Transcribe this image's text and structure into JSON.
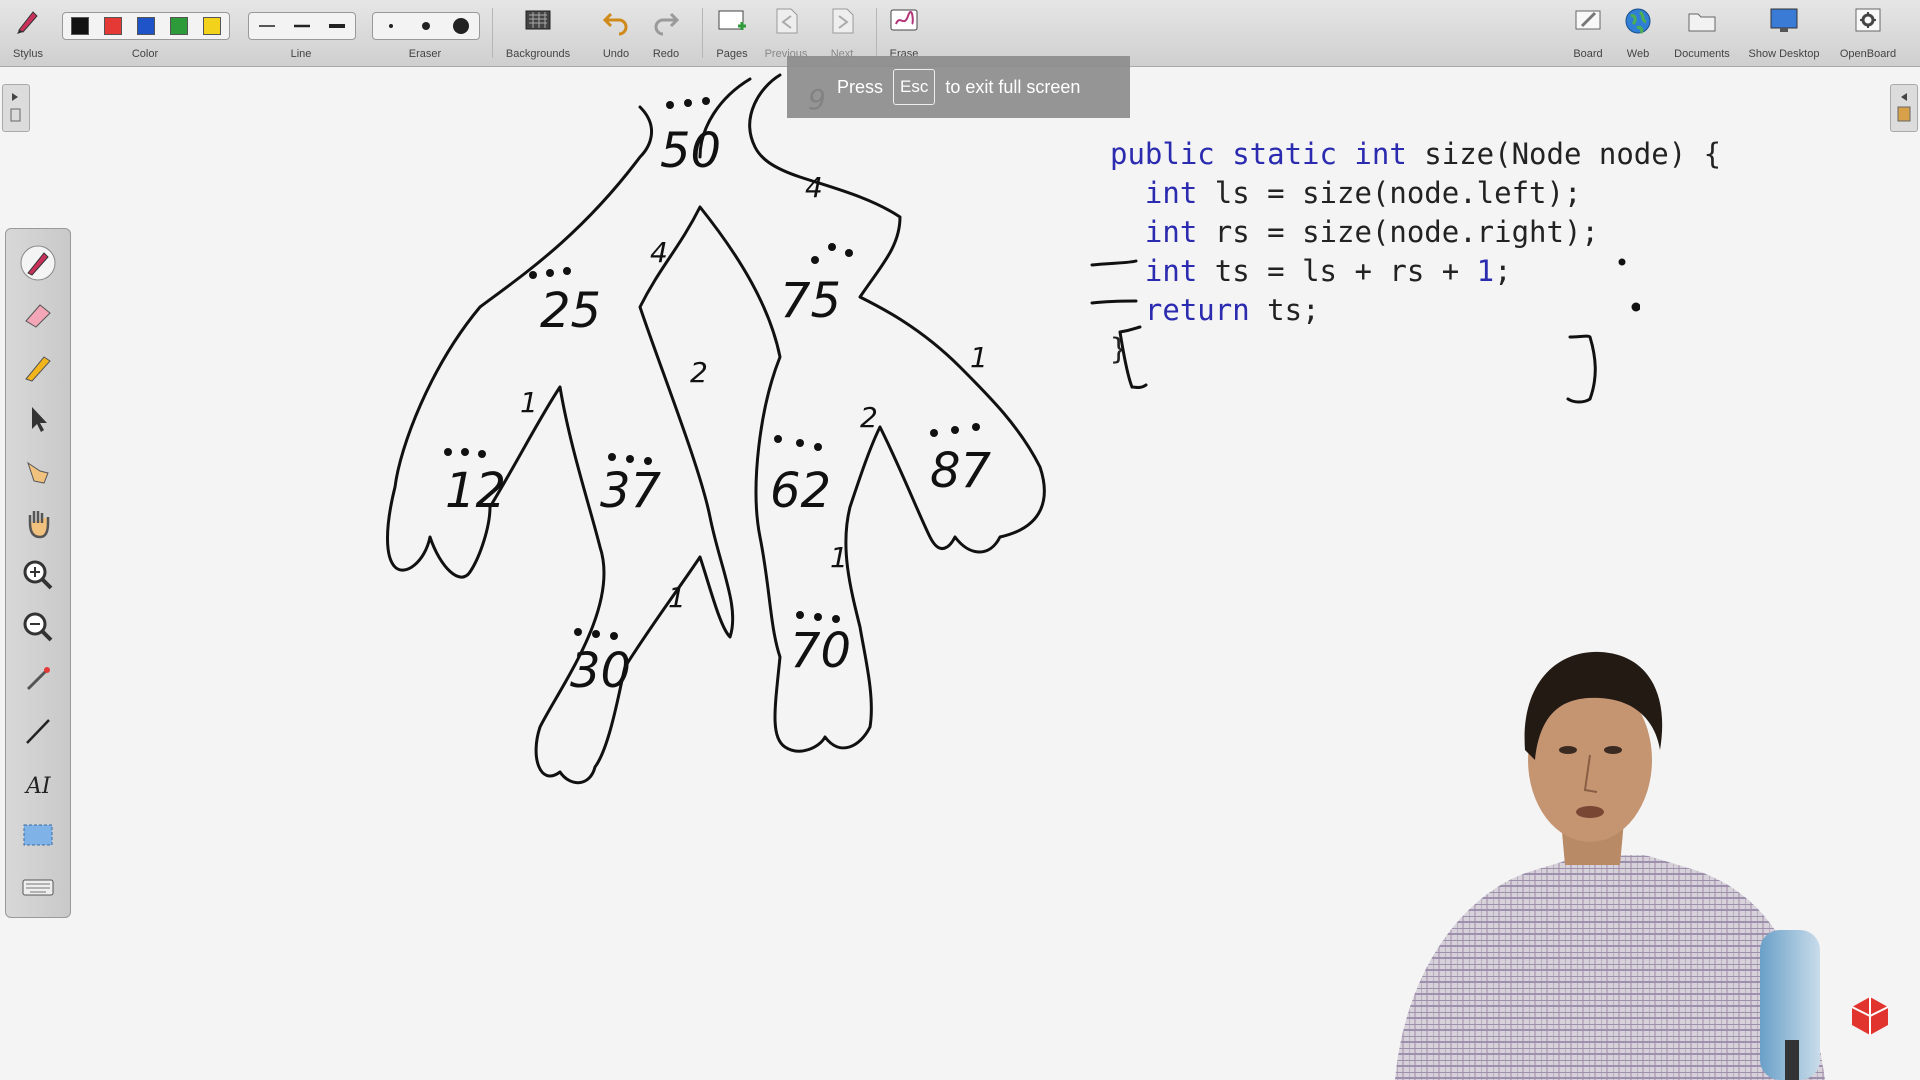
{
  "toolbar": {
    "stylus": "Stylus",
    "color": "Color",
    "line": "Line",
    "eraser": "Eraser",
    "backgrounds": "Backgrounds",
    "undo": "Undo",
    "redo": "Redo",
    "pages": "Pages",
    "previous": "Previous",
    "next": "Next",
    "erase": "Erase",
    "board": "Board",
    "web": "Web",
    "documents": "Documents",
    "show_desktop": "Show Desktop",
    "openboard": "OpenBoard",
    "colors": [
      "#111111",
      "#e53935",
      "#1e54c8",
      "#2e9b3a",
      "#f2d21b"
    ]
  },
  "toast": {
    "press": "Press",
    "key": "Esc",
    "suffix": "to exit full screen"
  },
  "tree": {
    "nodes": [
      "50",
      "25",
      "75",
      "12",
      "37",
      "62",
      "87",
      "30",
      "70"
    ],
    "edge_labels": [
      "9",
      "4",
      "4",
      "2",
      "1",
      "2",
      "1",
      "1",
      "1"
    ]
  },
  "code": {
    "line1_a": "public static int",
    "line1_b": " size(Node node) {",
    "line2_a": "int",
    "line2_b": " ls = size(node.left);",
    "line3_a": "int",
    "line3_b": " rs = size(node.right);",
    "line4_a": "int",
    "line4_b": " ts = ls + rs + ",
    "line4_c": "1",
    "line4_d": ";",
    "line5_a": "return",
    "line5_b": " ts;",
    "line6": "}"
  }
}
